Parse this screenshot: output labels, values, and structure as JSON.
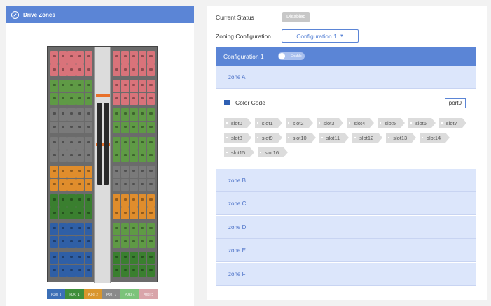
{
  "left": {
    "title": "Drive Zones",
    "ports": [
      {
        "label": "PORT 0",
        "color": "#3b6fb6"
      },
      {
        "label": "PORT 1",
        "color": "#3f8f3a"
      },
      {
        "label": "PORT 2",
        "color": "#d9962d"
      },
      {
        "label": "PORT 3",
        "color": "#8a8a8a"
      },
      {
        "label": "PORT 4",
        "color": "#7cc37a"
      },
      {
        "label": "PORT 5",
        "color": "#d9a5aa"
      }
    ]
  },
  "right": {
    "status_label": "Current Status",
    "status_value": "Disabled",
    "zoning_label": "Zoning Configuration",
    "zoning_value": "Configuration 1",
    "config_title": "Configuration 1",
    "toggle_label": "Enable",
    "zones": [
      "zone A",
      "zone B",
      "zone C",
      "zone D",
      "zone E",
      "zone F"
    ],
    "color_code_label": "Color Code",
    "color_code_color": "#2f5fb3",
    "port_value": "port0",
    "slots": [
      "slot0",
      "slot1",
      "slot2",
      "slot3",
      "slot4",
      "slot5",
      "slot6",
      "slot7",
      "slot8",
      "slot9",
      "slot10",
      "slot11",
      "slot12",
      "slot13",
      "slot14",
      "slot15",
      "slot16"
    ]
  }
}
